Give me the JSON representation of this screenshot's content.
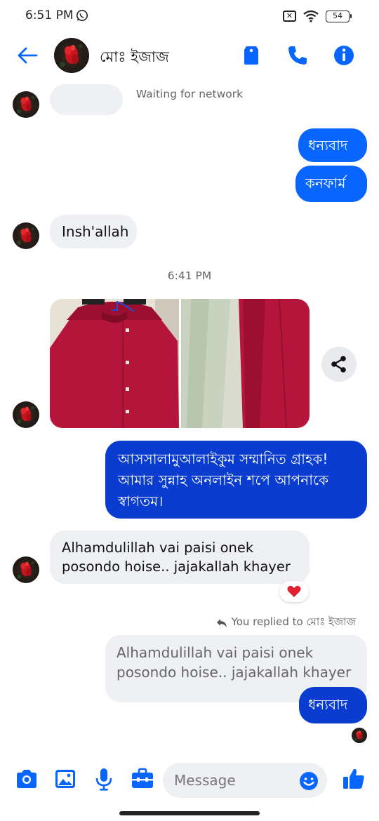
{
  "status_bar": {
    "time": "6:51 PM",
    "battery": "54"
  },
  "header": {
    "contact_name": "মোঃ ইজাজ"
  },
  "notices": {
    "network": "Waiting for network",
    "timestamp": "6:41 PM"
  },
  "messages": {
    "out_1": "ধন্যবাদ",
    "out_2": "কনফার্ম",
    "in_1": "Insh'allah",
    "out_3": "আসসালামুআলাইকুম সম্মানিত গ্রাহক! আমার সুন্নাহ অনলাইন শপে আপনাকে স্বাগতম।",
    "in_2": "Alhamdulillah vai paisi onek posondo hoise.. jajakallah khayer",
    "reaction": "heart",
    "reply_note": "You replied to মোঃ ইজাজ",
    "quoted": "Alhamdulillah vai paisi onek posondo hoise.. jajakallah khayer",
    "out_4": "ধন্যবাদ"
  },
  "composer": {
    "placeholder": "Message"
  },
  "colors": {
    "accent": "#0866ff",
    "dark_bubble": "#0a3ccf",
    "incoming_bubble": "#eef0f3"
  },
  "icons": [
    "back-arrow-icon",
    "tag-icon",
    "phone-icon",
    "info-icon",
    "share-icon",
    "heart-icon",
    "reply-icon",
    "camera-icon",
    "gallery-icon",
    "mic-icon",
    "briefcase-icon",
    "emoji-icon",
    "like-icon"
  ]
}
